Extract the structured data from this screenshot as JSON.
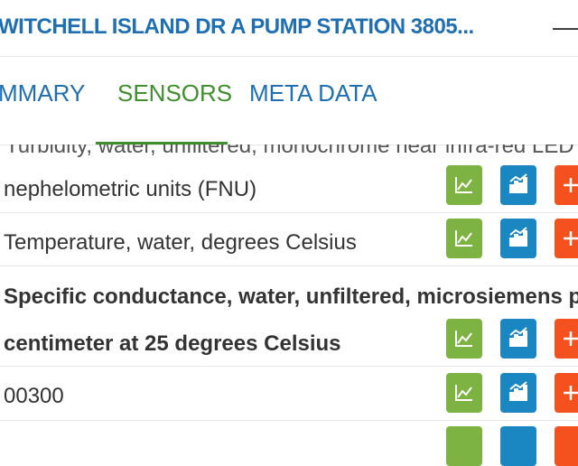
{
  "header": {
    "title": "WITCHELL ISLAND DR A PUMP STATION 3805...",
    "minimize_glyph": "—"
  },
  "tabs": [
    {
      "label": "MMARY",
      "active": false
    },
    {
      "label": "SENSORS",
      "active": true
    },
    {
      "label": "META DATA",
      "active": false
    }
  ],
  "partial_row_text": "Turbidity, water, unfiltered, monochrome near infra-red LED light,",
  "rows": [
    {
      "label": "nephelometric units (FNU)",
      "bold": false
    },
    {
      "label": "Temperature, water, degrees Celsius",
      "bold": false
    },
    {
      "label_line1": "Specific conductance, water, unfiltered, microsiemens per",
      "label_line2": "centimeter at 25 degrees Celsius",
      "bold": true
    },
    {
      "label": "00300",
      "bold": false
    }
  ],
  "buttons": {
    "chart_icon": "line-chart-icon",
    "stats_icon": "bar-chart-icon",
    "add_icon": "plus-icon",
    "colors": {
      "green": "#7cb342",
      "blue": "#1a86c2",
      "orange": "#f4511e"
    }
  }
}
